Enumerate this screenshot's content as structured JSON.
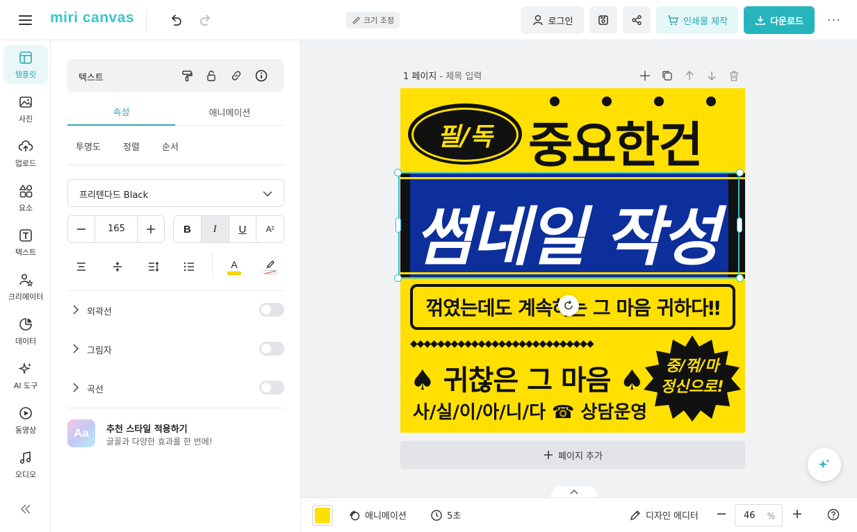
{
  "header": {
    "logo": "miri canvas",
    "resize_label": "크기 조정",
    "login_label": "로그인",
    "print_label": "인쇄물 제작",
    "download_label": "다운로드",
    "more_label": "···"
  },
  "rail": {
    "items": [
      {
        "label": "템플릿",
        "icon": "template-icon"
      },
      {
        "label": "사진",
        "icon": "photo-icon"
      },
      {
        "label": "업로드",
        "icon": "upload-icon"
      },
      {
        "label": "요소",
        "icon": "elements-icon"
      },
      {
        "label": "텍스트",
        "icon": "text-icon"
      },
      {
        "label": "크리에이터",
        "icon": "creator-icon"
      },
      {
        "label": "데이터",
        "icon": "data-icon"
      },
      {
        "label": "AI 도구",
        "icon": "ai-tools-icon"
      },
      {
        "label": "동영상",
        "icon": "video-icon"
      },
      {
        "label": "오디오",
        "icon": "audio-icon"
      }
    ]
  },
  "panel": {
    "element_title": "텍스트",
    "tabs": [
      "속성",
      "애니메이션"
    ],
    "subtabs": [
      "투명도",
      "정렬",
      "순서"
    ],
    "font_name": "프리텐다드 Black",
    "font_size": "165",
    "format": {
      "bold": "B",
      "italic": "I",
      "underline": "U",
      "superscript": "A²"
    },
    "text_color_glyph": "A",
    "toggles": [
      "외곽선",
      "그림자",
      "곡선"
    ],
    "recommend_title": "추천 스타일 적용하기",
    "recommend_desc": "글꼴과 다양한 효과를 한 번에!",
    "recommend_badge": "Aa"
  },
  "canvas": {
    "page_label": "1 페이지",
    "page_sep": " - ",
    "page_title_placeholder": "제목 입력",
    "add_page_label": "페이지 추가",
    "design": {
      "badge_text": "필/독",
      "headline": "중요한건",
      "main_text": "썸네일 작성",
      "box_text": "꺾였는데도 계속하는 그 마음 귀하다‼",
      "diamonds": "◆◆◆◆◆◆◆◆◆◆◆◆◆◆◆◆◆◆◆◆◆◆◆◆◆◆◆",
      "spade_text": "♠ 귀찮은 그 마음 ♠",
      "bottom_text": "사/실/이/아/니/다 ☎ 상담운영",
      "burst_line1": "중/꺾/마",
      "burst_line2": "정신으로!"
    },
    "colors": {
      "background": "#ffe000",
      "band": "#0d2f9c",
      "accent": "#26b5bd"
    }
  },
  "bottombar": {
    "animation_label": "애니메이션",
    "duration_label": "5초",
    "design_editor_label": "디자인 에디터",
    "zoom_value": "46",
    "zoom_unit": "%"
  }
}
